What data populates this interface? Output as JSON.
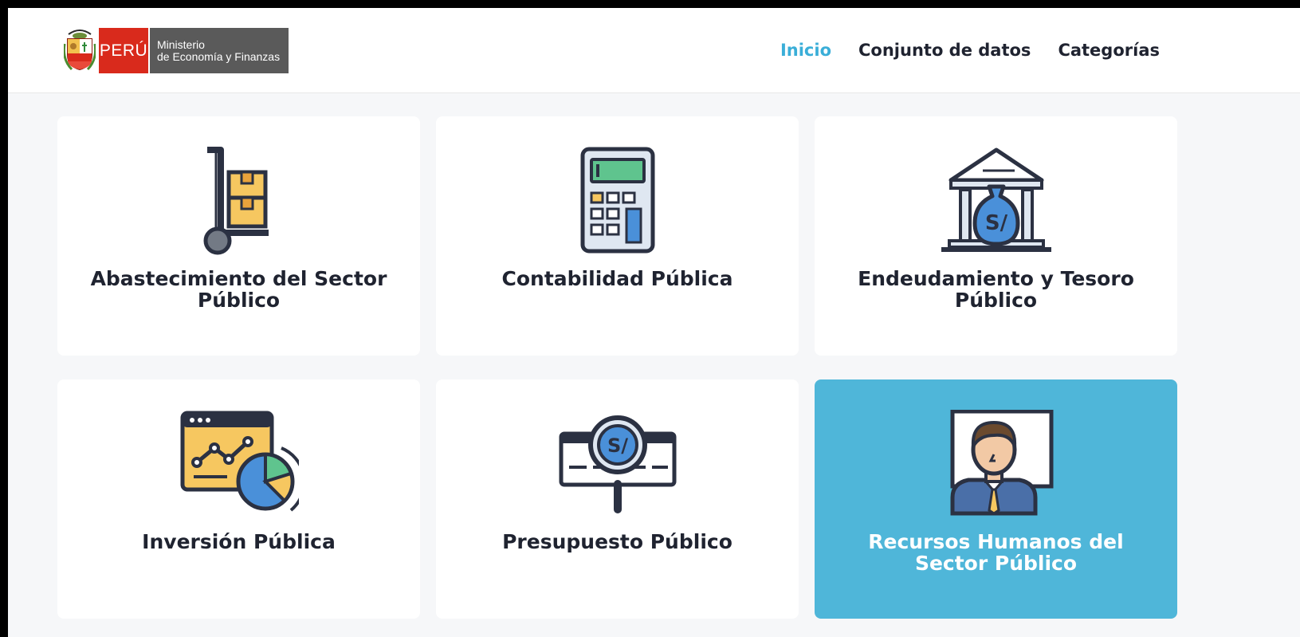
{
  "brand": {
    "country": "PERÚ",
    "ministry_line1": "Ministerio",
    "ministry_line2": "de Economía y Finanzas"
  },
  "nav": {
    "items": [
      {
        "label": "Inicio",
        "active": true
      },
      {
        "label": "Conjunto de datos",
        "active": false
      },
      {
        "label": "Categorías",
        "active": false
      }
    ]
  },
  "categories": [
    {
      "title": "Abastecimiento del Sector Público",
      "icon": "hand-truck-icon"
    },
    {
      "title": "Contabilidad Pública",
      "icon": "calculator-icon"
    },
    {
      "title": "Endeudamiento y Tesoro Público",
      "icon": "bank-money-bag-icon"
    },
    {
      "title": "Inversión Pública",
      "icon": "chart-dashboard-icon"
    },
    {
      "title": "Presupuesto Público",
      "icon": "magnifier-coin-icon",
      "coin_label": "S/"
    },
    {
      "title": "Recursos Humanos del Sector Público",
      "icon": "employee-board-icon",
      "selected": true
    }
  ],
  "colors": {
    "accent": "#3aaed8",
    "selected_card": "#4fb6d9",
    "peru_red": "#d92a1c",
    "dark": "#1f2330"
  }
}
